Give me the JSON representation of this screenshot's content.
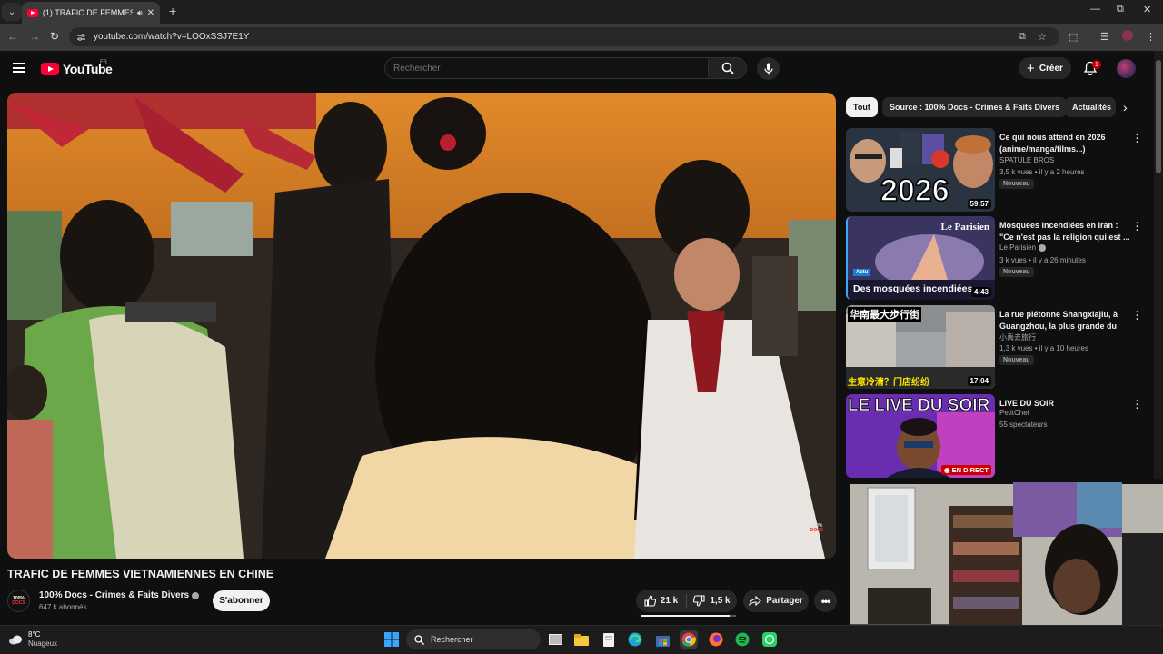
{
  "browser": {
    "tab_title": "(1) TRAFIC DE FEMMES VIETNA",
    "new_tab_glyph": "+",
    "url": "youtube.com/watch?v=LOOxSSJ7E1Y"
  },
  "header": {
    "logo_text": "YouTube",
    "logo_country": "FR",
    "search_placeholder": "Rechercher",
    "create_label": "Créer",
    "notif_count": "1"
  },
  "video": {
    "title": "TRAFIC DE FEMMES VIETNAMIENNES EN CHINE",
    "channel_name": "100% Docs - Crimes & Faits Divers",
    "subscribers": "647 k abonnés",
    "subscribe_label": "S'abonner",
    "likes": "21 k",
    "dislikes": "1,5 k",
    "like_ratio": 0.93,
    "share_label": "Partager",
    "watermark_line1": "100%",
    "watermark_line2": "DOCS",
    "channel_logo_line1": "100%",
    "channel_logo_line2": "DOCS"
  },
  "chips": [
    "Tout",
    "Source : 100% Docs - Crimes & Faits Divers",
    "Actualités"
  ],
  "recommendations": [
    {
      "title": "Ce qui nous attend en 2026 (anime/manga/films...)",
      "channel": "SPATULE BROS",
      "meta": "3,5 k vues • il y a 2 heures",
      "badge": "Nouveau",
      "duration": "59:57",
      "thumb_text": "2026"
    },
    {
      "title": "Mosquées incendiées en Iran : \"Ce n'est pas la religion qui est ...",
      "channel": "Le Parisien",
      "meta": "3 k vues • il y a 26 minutes",
      "badge": "Nouveau",
      "duration": "4:43",
      "thumb_brand": "Le Parisien",
      "thumb_tag": "Actu",
      "thumb_caption": "Des mosquées incendiées"
    },
    {
      "title": "La rue piétonne Shangxiajiu, à Guangzhou, la plus grande du su...",
      "channel": "小禹去旅行",
      "meta": "1,3 k vues • il y a 10 heures",
      "badge": "Nouveau",
      "duration": "17:04",
      "thumb_top": "华南最大步行街",
      "thumb_bottom": "生意冷清？门店纷纷"
    },
    {
      "title": "LIVE DU SOIR",
      "channel": "PetitChef",
      "meta": "55 spectateurs",
      "thumb_text": "LE LIVE DU SOIR",
      "live_label": "EN DIRECT"
    }
  ],
  "taskbar": {
    "temperature": "8°C",
    "condition": "Nuageux",
    "search_label": "Rechercher"
  },
  "colors": {
    "yt_red": "#ff0033",
    "background": "#0f0f0f",
    "chip_bg": "#272727",
    "live_red": "#cc0000"
  }
}
